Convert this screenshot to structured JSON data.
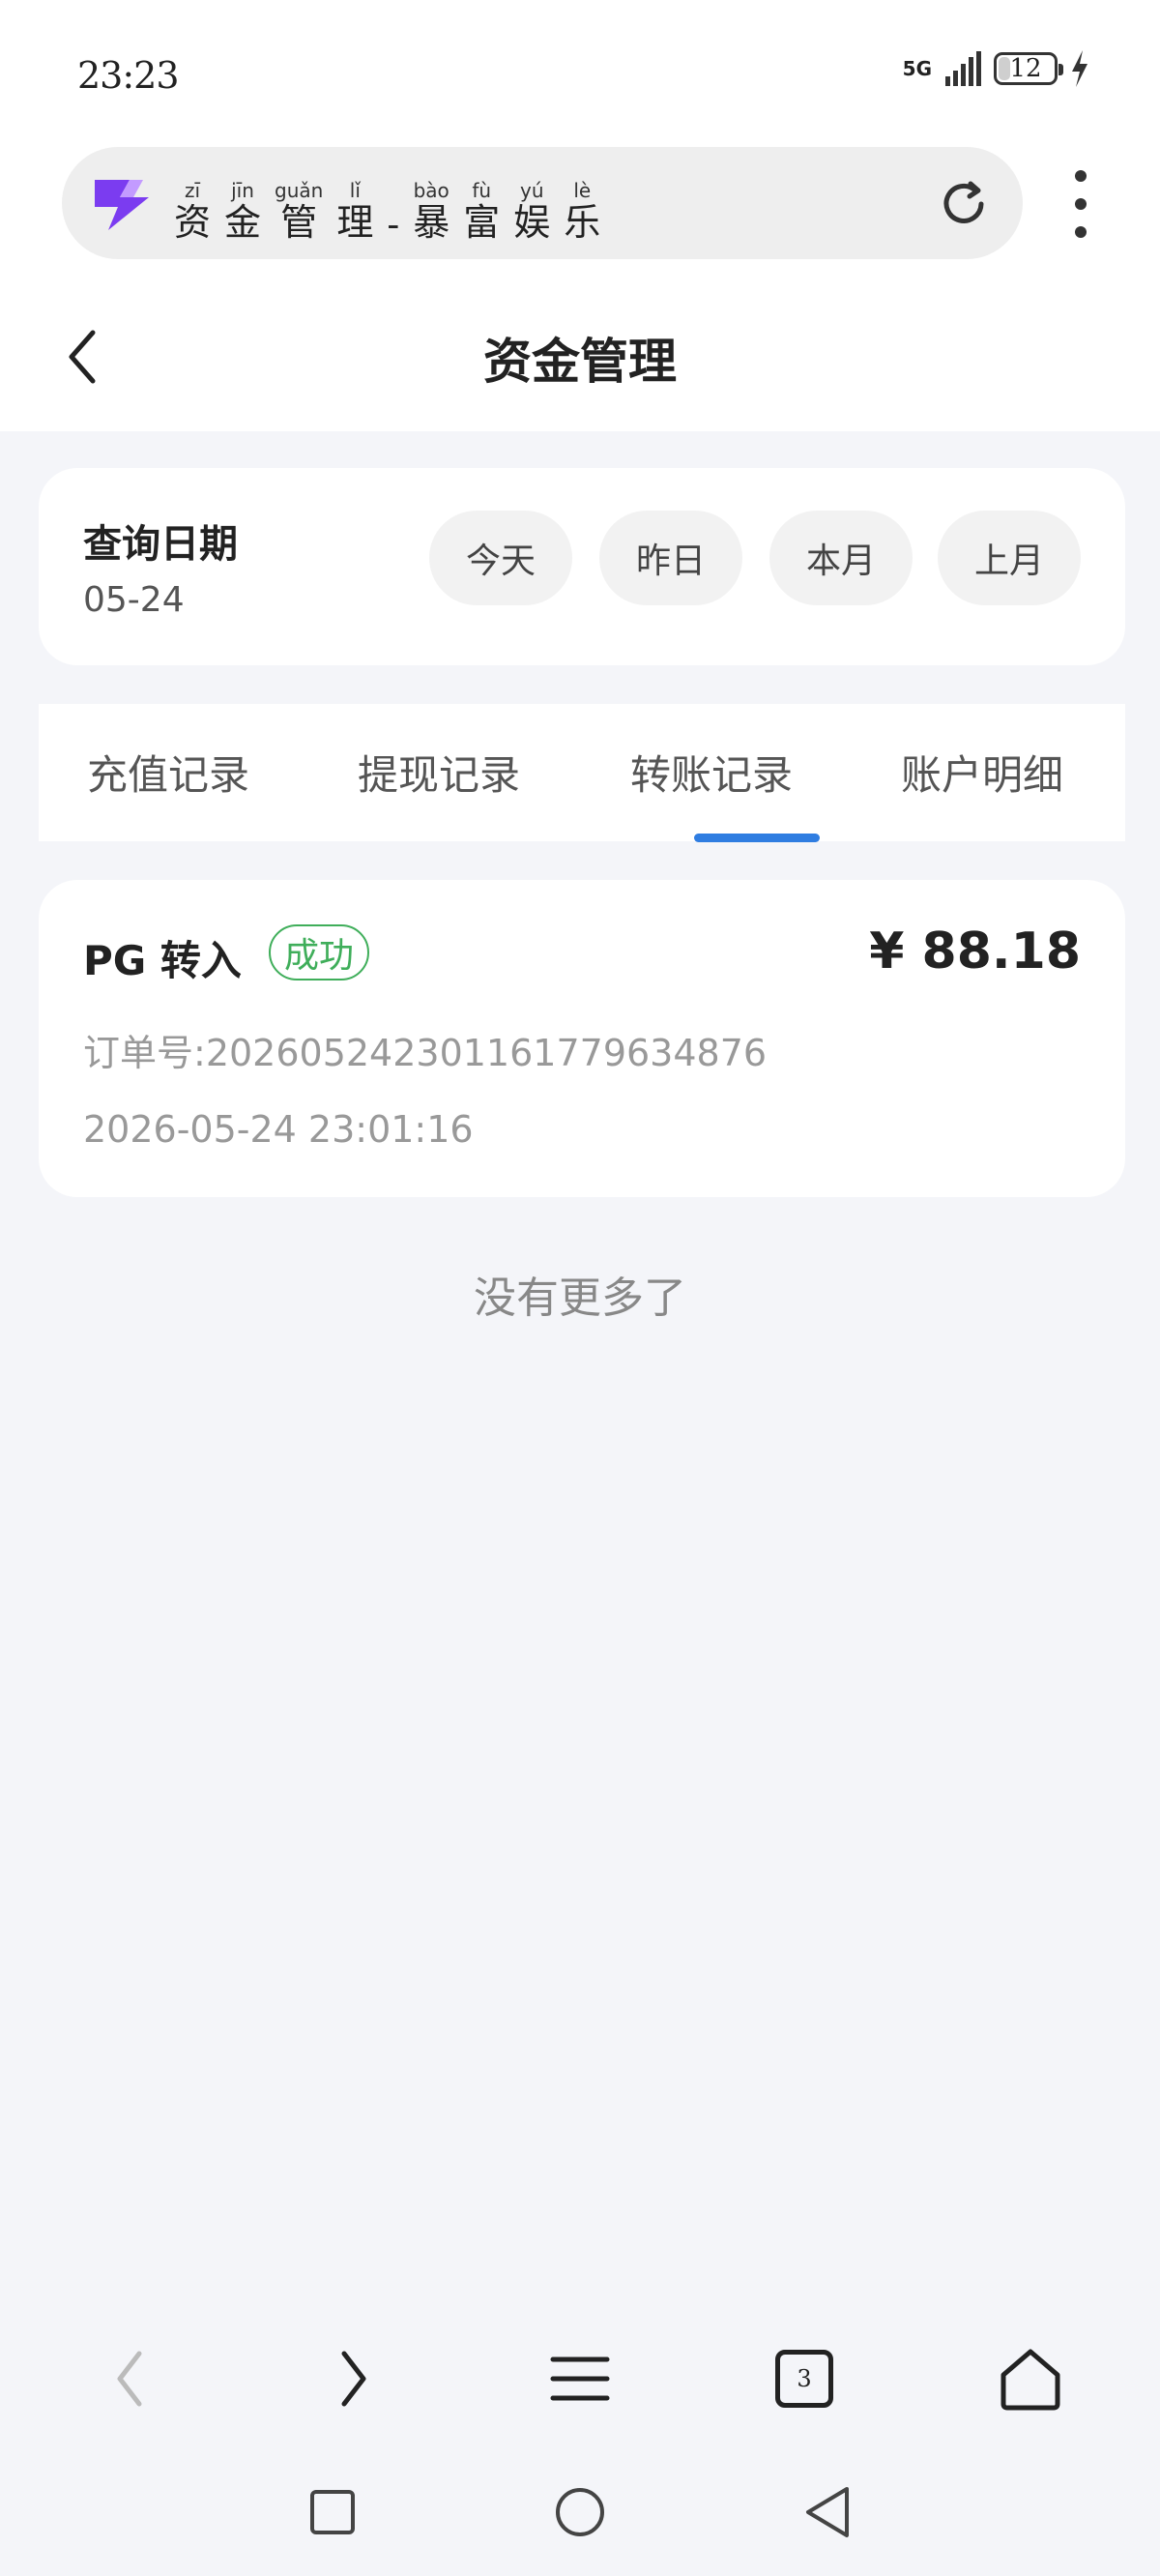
{
  "status_bar": {
    "time": "23:23",
    "network": "5G",
    "battery": "12"
  },
  "browser": {
    "url_title": "资金管理 - 暴富娱乐",
    "url_title_pinyin": [
      {
        "char": "资",
        "pinyin": "zī"
      },
      {
        "char": "金",
        "pinyin": "jīn"
      },
      {
        "char": "管",
        "pinyin": "guǎn"
      },
      {
        "char": "理",
        "pinyin": "lǐ"
      },
      {
        "char": "-",
        "pinyin": ""
      },
      {
        "char": "暴",
        "pinyin": "bào"
      },
      {
        "char": "富",
        "pinyin": "fù"
      },
      {
        "char": "娱",
        "pinyin": "yú"
      },
      {
        "char": "乐",
        "pinyin": "lè"
      }
    ],
    "tab_count": "3",
    "logo_color": "#7b3cf0"
  },
  "header": {
    "title": "资金管理"
  },
  "date_filter": {
    "label": "查询日期",
    "value": "05-24",
    "options": [
      {
        "label": "今天",
        "active": true
      },
      {
        "label": "昨日",
        "active": false
      },
      {
        "label": "本月",
        "active": false
      },
      {
        "label": "上月",
        "active": false
      }
    ]
  },
  "tabs": [
    {
      "label": "充值记录",
      "active": false
    },
    {
      "label": "提现记录",
      "active": false
    },
    {
      "label": "转账记录",
      "active": true
    },
    {
      "label": "账户明细",
      "active": false
    }
  ],
  "records": [
    {
      "title": "PG 转入",
      "status": "成功",
      "amount": "¥ 88.18",
      "order_label": "订单号:",
      "order_no": "20260524230116177963487 6",
      "time": "2026-05-24 23:01:16"
    }
  ],
  "list_end": "没有更多了",
  "colors": {
    "accent": "#2f7de1",
    "success": "#3fae5a",
    "background": "#f4f5f9"
  }
}
